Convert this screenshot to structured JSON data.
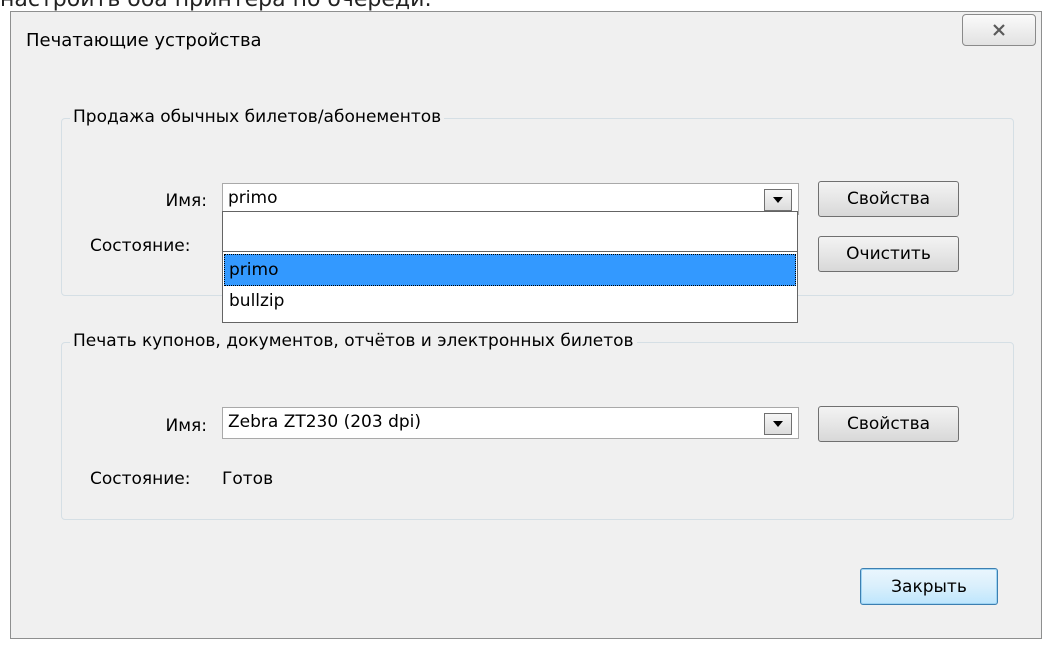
{
  "top_text": "настроить оба принтера по очереди:",
  "window": {
    "title": "Печатающие устройства",
    "close_icon": "close-icon"
  },
  "group1": {
    "legend": "Продажа обычных билетов/абонементов",
    "name_label": "Имя:",
    "name_value": "primo",
    "state_label": "Состояние:",
    "properties_label": "Свойства",
    "clear_label": "Очистить",
    "dropdown_options": [
      "primo",
      "bullzip"
    ],
    "selected_option": "primo"
  },
  "group2": {
    "legend": "Печать купонов, документов, отчётов и электронных билетов",
    "name_label": "Имя:",
    "name_value": "Zebra ZT230 (203 dpi)",
    "state_label": "Состояние:",
    "state_value": "Готов",
    "properties_label": "Свойства"
  },
  "footer": {
    "close_label": "Закрыть"
  },
  "colors": {
    "selection": "#3399ff",
    "window_bg": "#f0f0f0"
  }
}
